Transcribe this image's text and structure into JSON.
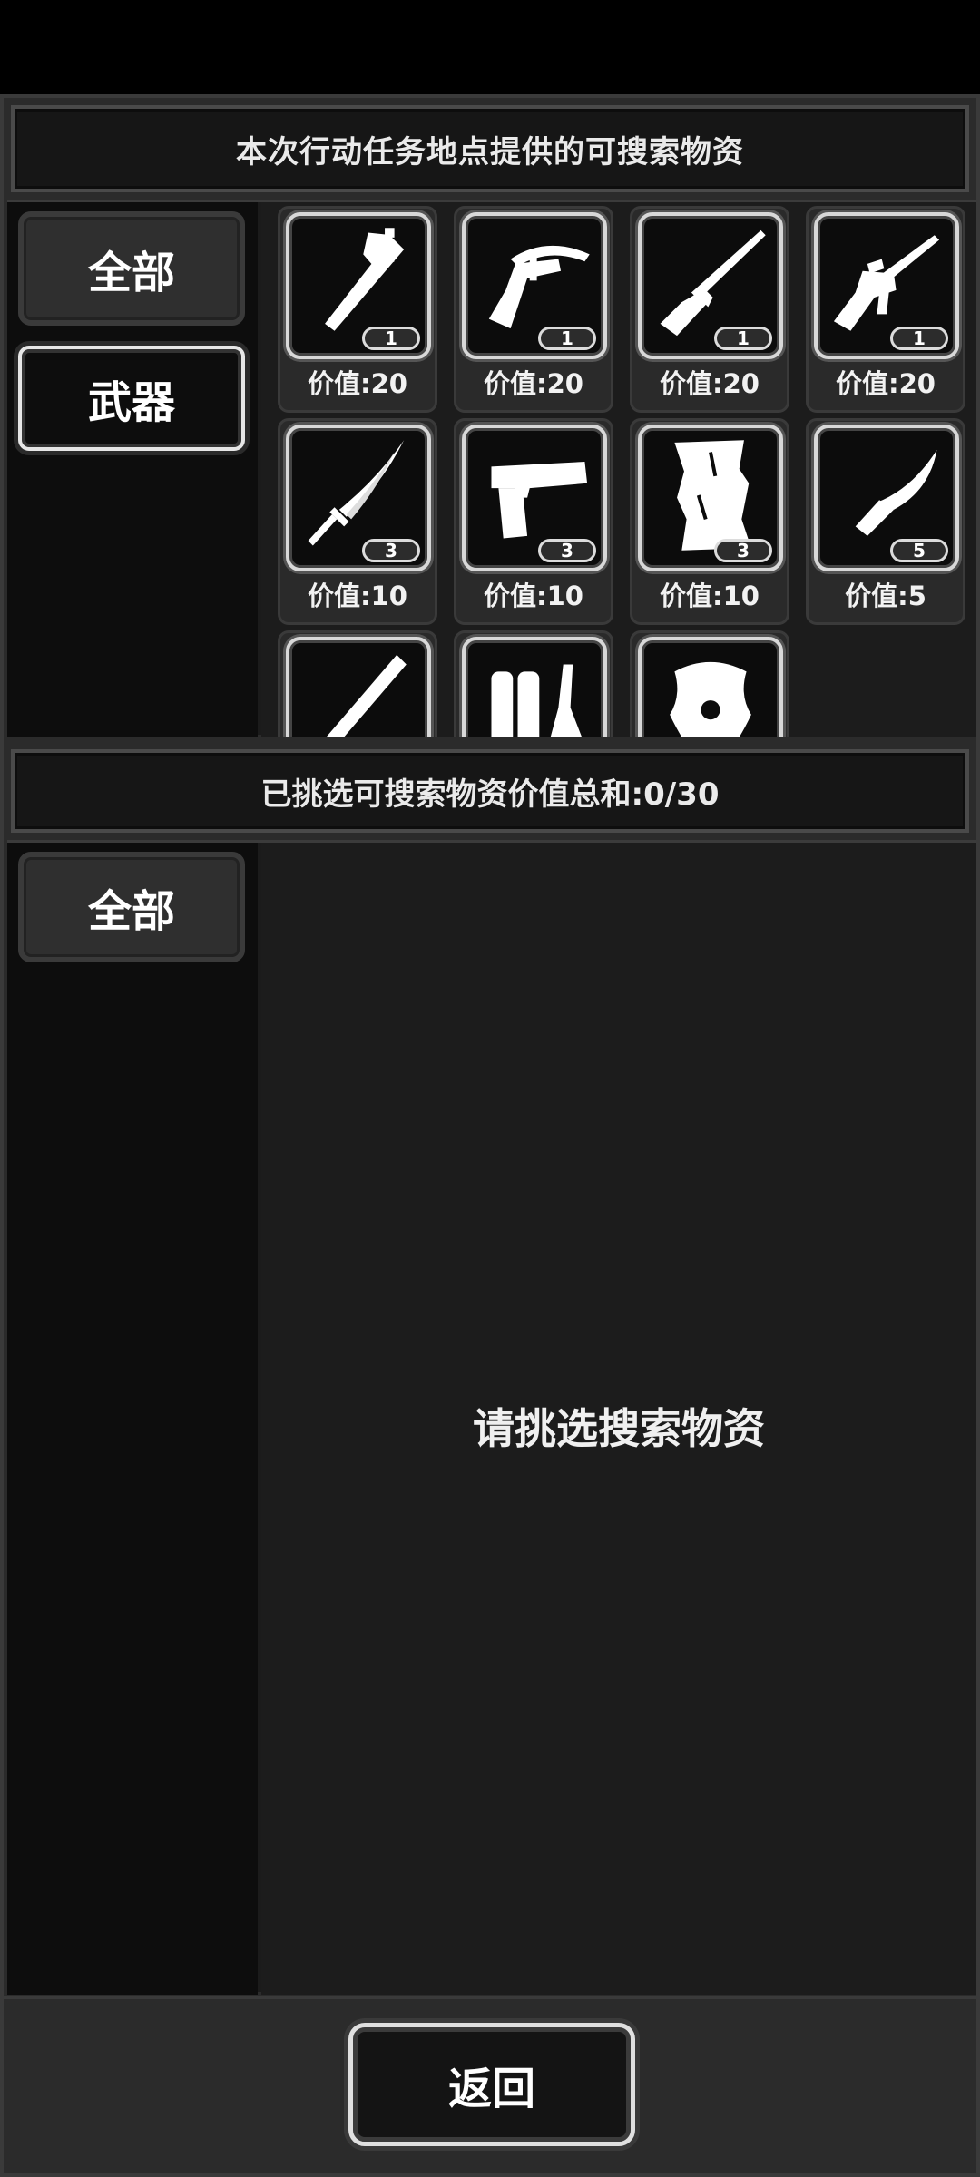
{
  "header": {
    "title": "本次行动任务地点提供的可搜索物资"
  },
  "top_tabs": [
    {
      "label": "全部",
      "active": true
    },
    {
      "label": "武器",
      "active": false
    }
  ],
  "items": [
    {
      "icon": "axe-icon",
      "qty": "1",
      "value": "价值:20"
    },
    {
      "icon": "crossbow-icon",
      "qty": "1",
      "value": "价值:20"
    },
    {
      "icon": "rifle-icon",
      "qty": "1",
      "value": "价值:20"
    },
    {
      "icon": "assault-rifle-icon",
      "qty": "1",
      "value": "价值:20"
    },
    {
      "icon": "katana-icon",
      "qty": "3",
      "value": "价值:10"
    },
    {
      "icon": "pistol-icon",
      "qty": "3",
      "value": "价值:10"
    },
    {
      "icon": "wooden-plank-icon",
      "qty": "3",
      "value": "价值:10"
    },
    {
      "icon": "machete-icon",
      "qty": "5",
      "value": "价值:5"
    },
    {
      "icon": "baton-icon",
      "qty": "",
      "value": ""
    },
    {
      "icon": "fuel-tanks-icon",
      "qty": "",
      "value": ""
    },
    {
      "icon": "shield-icon",
      "qty": "",
      "value": ""
    }
  ],
  "summary": {
    "text": "已挑选可搜索物资价值总和:0/30"
  },
  "bottom_tabs": [
    {
      "label": "全部",
      "active": true
    }
  ],
  "selected": {
    "empty_text": "请挑选搜索物资"
  },
  "footer": {
    "back_label": "返回"
  }
}
